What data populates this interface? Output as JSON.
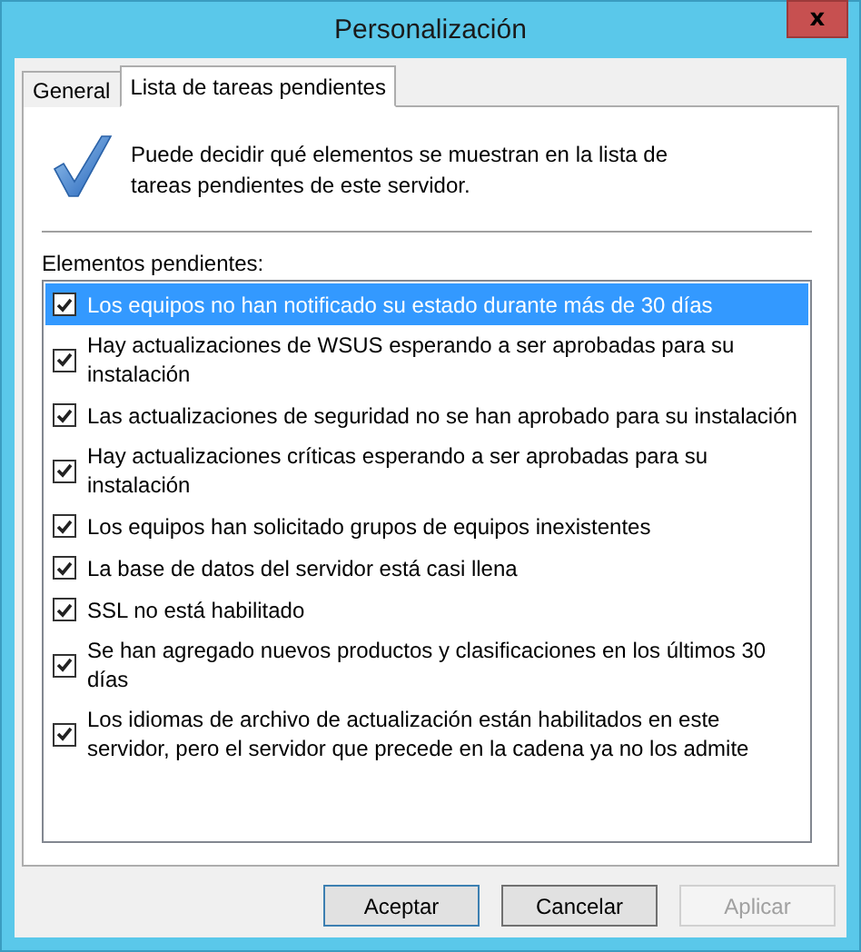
{
  "window": {
    "title": "Personalización",
    "close": "x"
  },
  "tabs": [
    {
      "label": "General",
      "selected": false
    },
    {
      "label": "Lista de tareas pendientes",
      "selected": true
    }
  ],
  "description": "Puede decidir qué elementos se muestran en la lista de tareas pendientes de este servidor.",
  "list_label": "Elementos pendientes:",
  "items": [
    {
      "label": "Los equipos no han notificado su estado durante más de 30 días",
      "checked": true,
      "selected": true
    },
    {
      "label": "Hay actualizaciones de WSUS esperando a ser aprobadas para su instalación",
      "checked": true,
      "selected": false
    },
    {
      "label": "Las actualizaciones de seguridad no se han aprobado para su instalación",
      "checked": true,
      "selected": false
    },
    {
      "label": "Hay actualizaciones críticas esperando a ser aprobadas para su instalación",
      "checked": true,
      "selected": false
    },
    {
      "label": "Los equipos han solicitado grupos de equipos inexistentes",
      "checked": true,
      "selected": false
    },
    {
      "label": "La base de datos del servidor está casi llena",
      "checked": true,
      "selected": false
    },
    {
      "label": "SSL no está habilitado",
      "checked": true,
      "selected": false
    },
    {
      "label": "Se han agregado nuevos productos y clasificaciones en los últimos 30 días",
      "checked": true,
      "selected": false
    },
    {
      "label": "Los idiomas de archivo de actualización están habilitados en este servidor, pero el servidor que precede en la cadena ya no los admite",
      "checked": true,
      "selected": false
    }
  ],
  "buttons": [
    {
      "label": "Aceptar",
      "default": true,
      "disabled": false
    },
    {
      "label": "Cancelar",
      "default": false,
      "disabled": false
    },
    {
      "label": "Aplicar",
      "default": false,
      "disabled": true
    }
  ]
}
